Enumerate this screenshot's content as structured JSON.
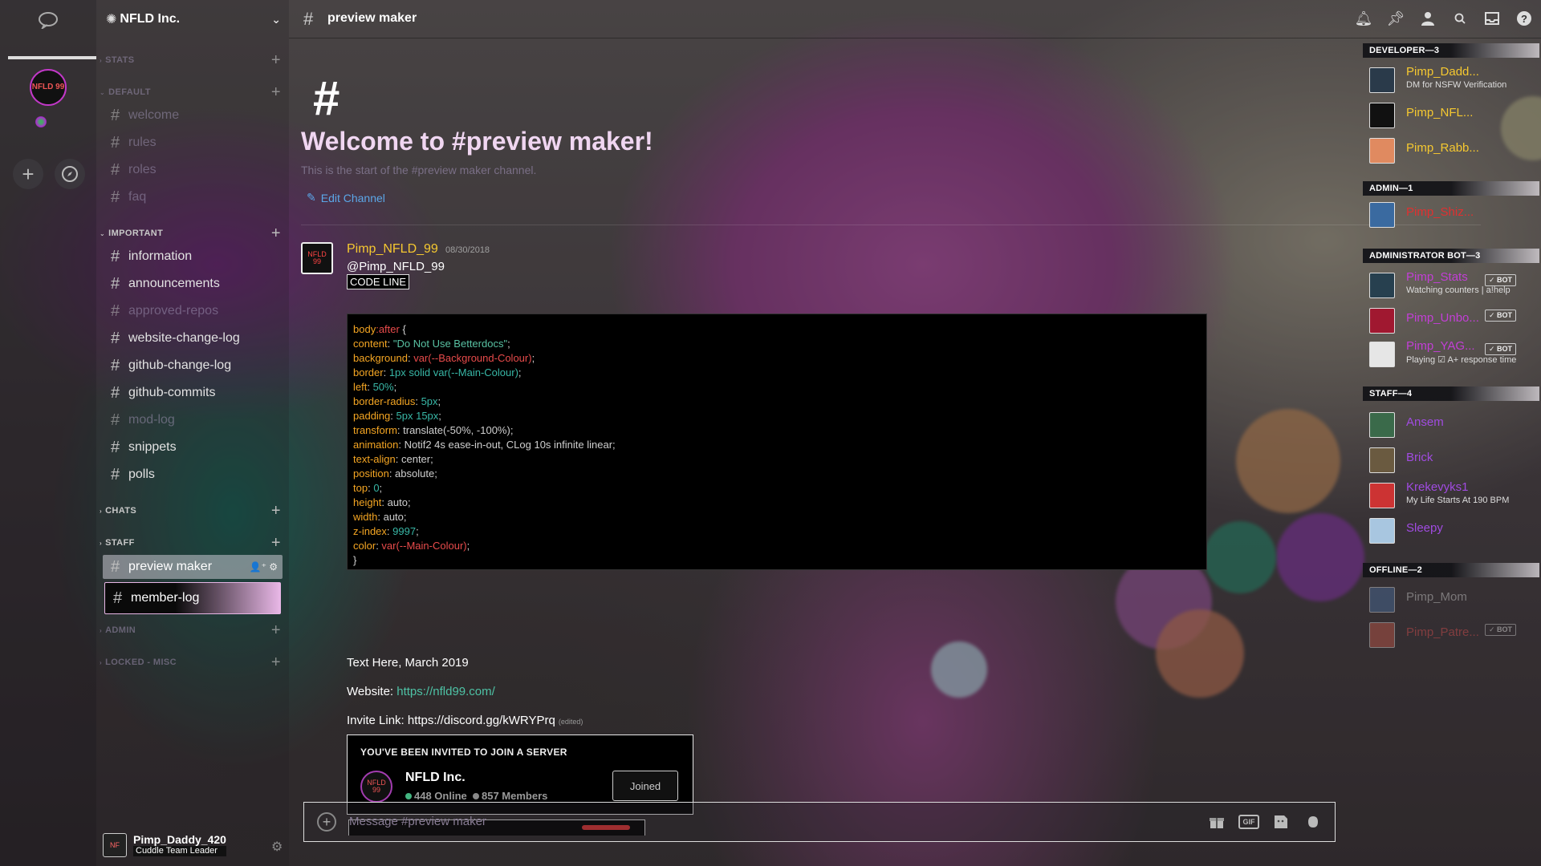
{
  "server": {
    "name": "NFLD Inc.",
    "icon_text": "NFLD 99"
  },
  "channel": {
    "name": "preview maker",
    "welcome_title": "Welcome to #preview maker!",
    "welcome_sub": "This is the start of the #preview maker channel.",
    "edit_label": "Edit Channel"
  },
  "sidebar": {
    "categories": [
      {
        "name": "STATS"
      },
      {
        "name": "DEFAULT"
      },
      {
        "name": "IMPORTANT"
      },
      {
        "name": "CHATS"
      },
      {
        "name": "STAFF"
      },
      {
        "name": "ADMIN"
      },
      {
        "name": "LOCKED - MISC"
      }
    ],
    "default_channels": [
      "welcome",
      "rules",
      "roles",
      "faq"
    ],
    "important_channels": [
      "information",
      "announcements",
      "approved-repos",
      "website-change-log",
      "github-change-log",
      "github-commits",
      "mod-log",
      "snippets",
      "polls"
    ],
    "staff_channels": [
      "preview maker",
      "member-log"
    ]
  },
  "user_panel": {
    "name": "Pimp_Daddy_420",
    "status": "Cuddle Team Leader"
  },
  "message": {
    "author": "Pimp_NFLD_99",
    "time": "08/30/2018",
    "mention": "@Pimp_NFLD_99",
    "tag": "CODE LINE",
    "code": {
      "selector": "body",
      "pseudo": ":after",
      "open": " {",
      "close": "}",
      "lines": [
        [
          "content",
          "\"Do Not Use Betterdocs\""
        ],
        [
          "background",
          "var(--Background-Colour)"
        ],
        [
          "border",
          "1px solid var(--Main-Colour)"
        ],
        [
          "left",
          "50%"
        ],
        [
          "border-radius",
          "5px"
        ],
        [
          "padding",
          "5px 15px"
        ],
        [
          "transform",
          "translate(-50%, -100%)"
        ],
        [
          "animation",
          "Notif2 4s ease-in-out, CLog 10s infinite linear"
        ],
        [
          "text-align",
          "center"
        ],
        [
          "position",
          "absolute"
        ],
        [
          "top",
          "0"
        ],
        [
          "height",
          "auto"
        ],
        [
          "width",
          "auto"
        ],
        [
          "z-index",
          "9997"
        ],
        [
          "color",
          "var(--Main-Colour)"
        ]
      ]
    },
    "text_here": "Text Here, March 2019",
    "website_label": "Website: ",
    "website_url": "https://nfld99.com/",
    "invite_label": "Invite Link: https://discord.gg/kWRYPrq",
    "edited": "(edited)",
    "invite_card": {
      "heading": "YOU'VE BEEN INVITED TO JOIN A SERVER",
      "server": "NFLD Inc.",
      "online": "448 Online",
      "members": "857 Members",
      "button": "Joined"
    }
  },
  "composer": {
    "placeholder": "Message #preview maker",
    "gif_label": "GIF"
  },
  "members": {
    "groups": [
      {
        "name": "DEVELOPER—3"
      },
      {
        "name": "ADMIN—1"
      },
      {
        "name": "ADMINISTRATOR BOT—3"
      },
      {
        "name": "STAFF—4"
      },
      {
        "name": "OFFLINE—2"
      }
    ],
    "list": [
      {
        "name": "Pimp_Dadd...",
        "status": "DM for NSFW Verification",
        "color": "#f5c830"
      },
      {
        "name": "Pimp_NFL...",
        "status": "",
        "color": "#f5c830"
      },
      {
        "name": "Pimp_Rabb...",
        "status": "",
        "color": "#f5c830"
      },
      {
        "name": "Pimp_Shiz...",
        "status": "",
        "color": "#e03030"
      },
      {
        "name": "Pimp_Stats",
        "status": "Watching counters | a!help",
        "color": "#c23fd6",
        "bot": "✓ BOT"
      },
      {
        "name": "Pimp_Unbo...",
        "status": "",
        "color": "#c23fd6",
        "bot": "✓ BOT"
      },
      {
        "name": "Pimp_YAG...",
        "status": "Playing ☑ A+ response time",
        "color": "#c23fd6",
        "bot": "✓ BOT"
      },
      {
        "name": "Ansem",
        "status": "",
        "color": "#a04be0"
      },
      {
        "name": "Brick",
        "status": "",
        "color": "#a04be0"
      },
      {
        "name": "Krekevyks1",
        "status": "My Life Starts At 190 BPM",
        "color": "#a04be0"
      },
      {
        "name": "Sleepy",
        "status": "",
        "color": "#a04be0"
      },
      {
        "name": "Pimp_Mom",
        "status": "",
        "color": "#cfcfcf"
      },
      {
        "name": "Pimp_Patre...",
        "status": "",
        "color": "#e05050",
        "bot": "✓ BOT"
      }
    ]
  }
}
